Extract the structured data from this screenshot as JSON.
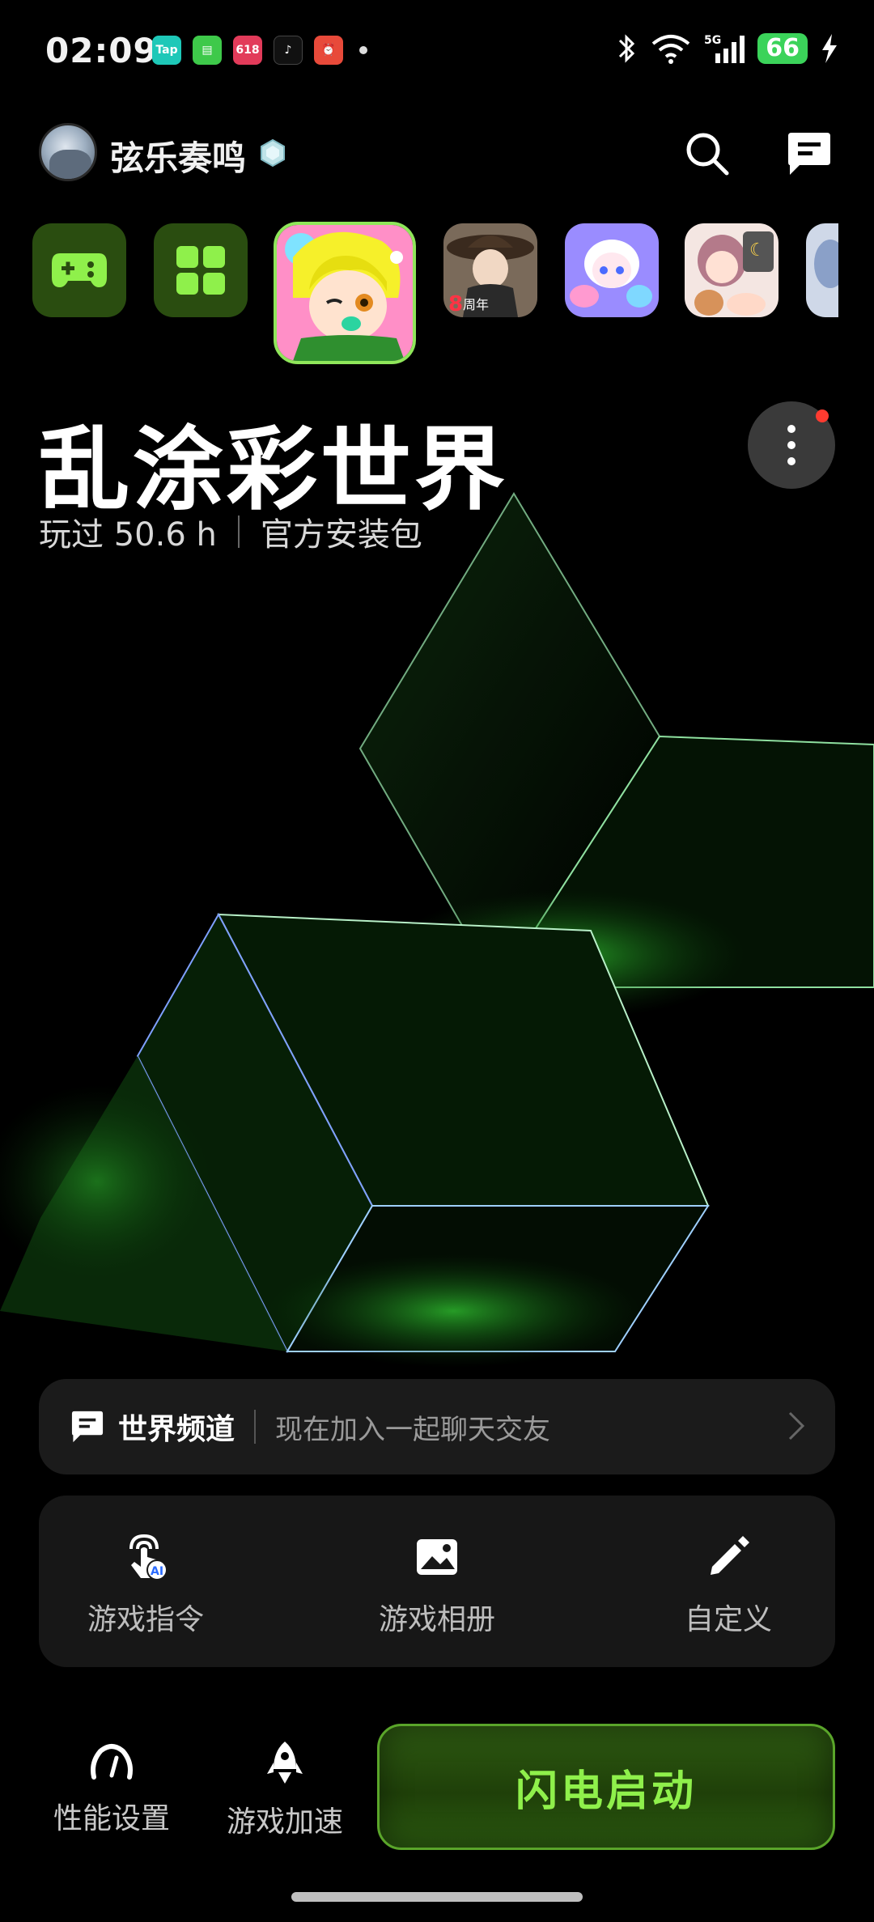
{
  "status_bar": {
    "time": "02:09",
    "notification_apps": [
      "Tap",
      "messages",
      "618",
      "tiktok",
      "clock"
    ],
    "network": "5G",
    "battery": "66"
  },
  "header": {
    "username": "弦乐奏鸣",
    "icons": [
      "search-icon",
      "chat-icon"
    ]
  },
  "carousel": {
    "selected_game": "乱涂彩世界",
    "other_games_count": 5
  },
  "game": {
    "title": "乱涂彩世界",
    "played": "玩过 50.6 h",
    "source": "官方安装包"
  },
  "world_channel": {
    "label": "世界频道",
    "text": "现在加入一起聊天交友"
  },
  "tools": [
    {
      "label": "游戏指令",
      "icon": "touch-ai-icon"
    },
    {
      "label": "游戏相册",
      "icon": "album-icon"
    },
    {
      "label": "自定义",
      "icon": "pencil-icon"
    }
  ],
  "bottom": {
    "performance": "性能设置",
    "boost": "游戏加速",
    "launch": "闪电启动"
  },
  "colors": {
    "accent": "#8ff04b",
    "tile_bg": "#2a4d10",
    "badge_red": "#ff3b30"
  }
}
